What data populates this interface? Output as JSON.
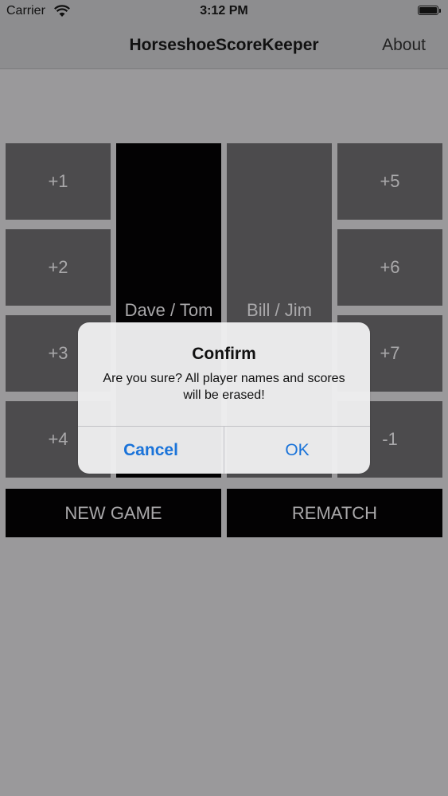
{
  "status_bar": {
    "carrier": "Carrier",
    "time": "3:12 PM",
    "wifi_icon": "wifi-icon",
    "battery_icon": "battery-icon"
  },
  "nav": {
    "title": "HorseshoeScoreKeeper",
    "about": "About"
  },
  "left_scores": [
    "+1",
    "+2",
    "+3",
    "+4"
  ],
  "right_scores": [
    "+5",
    "+6",
    "+7",
    "-1"
  ],
  "teams": {
    "team1": "Dave / Tom",
    "team2": "Bill / Jim"
  },
  "buttons": {
    "new_game": "NEW GAME",
    "rematch": "REMATCH"
  },
  "alert": {
    "title": "Confirm",
    "message": "Are you sure? All player names and scores will be erased!",
    "cancel": "Cancel",
    "ok": "OK",
    "accent_color": "#1a73d9"
  }
}
